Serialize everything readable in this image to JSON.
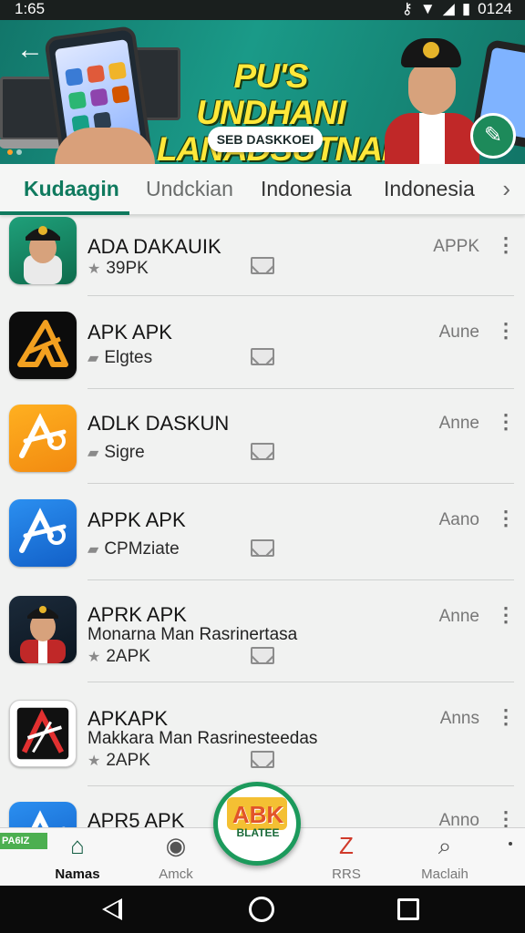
{
  "status_bar": {
    "time": "1:65",
    "right_text": "0124"
  },
  "banner": {
    "title_line1": "PU'S UNDHANI",
    "title_line2": "LANADSUTNAI",
    "pill_text": "SEB DASKKOEI"
  },
  "tabs": [
    {
      "label": "Kudaagin"
    },
    {
      "label": "Undckian"
    },
    {
      "label": "Indonesia"
    },
    {
      "label": "Indonesia"
    }
  ],
  "apps": [
    {
      "name": "ADA DAKAUIK",
      "sub": "39PK",
      "sub_icon": "star-icon",
      "desc": "",
      "meta": "APPK"
    },
    {
      "name": "APK APK",
      "sub": "Elgtes",
      "sub_icon": "tag-icon",
      "desc": "",
      "meta": "Aune"
    },
    {
      "name": "ADLK DASKUN",
      "sub": "Sigre",
      "sub_icon": "tag-icon",
      "desc": "",
      "meta": "Anne"
    },
    {
      "name": "APPK APK",
      "sub": "CPMziate",
      "sub_icon": "tag-icon",
      "desc": "",
      "meta": "Aano"
    },
    {
      "name": "APRK APK",
      "sub": "2APK",
      "sub_icon": "star-icon",
      "desc": "Monarna Man Rasrinertasa",
      "meta": "Anne"
    },
    {
      "name": "APKAPK",
      "sub": "2APK",
      "sub_icon": "star-icon",
      "desc": "Makkara Man Rasrinesteedas",
      "meta": "Anns"
    },
    {
      "name": "APR5 APK",
      "sub": "",
      "sub_icon": "",
      "desc": "",
      "meta": "Anno"
    }
  ],
  "bottom_nav": {
    "badge": "PA6IZ",
    "items": [
      {
        "label": "Namas",
        "icon": "home-icon"
      },
      {
        "label": "Amck",
        "icon": "globe-icon"
      },
      {
        "label": "RRS",
        "icon": "rrs-icon"
      },
      {
        "label": "Maclaih",
        "icon": "search-icon"
      }
    ],
    "fab_label": "ABK",
    "fab_sub": "BLATEE"
  },
  "colors": {
    "accent": "#0f7a5e",
    "banner_bg": "#1a9a88",
    "banner_title": "#ffe83a"
  }
}
